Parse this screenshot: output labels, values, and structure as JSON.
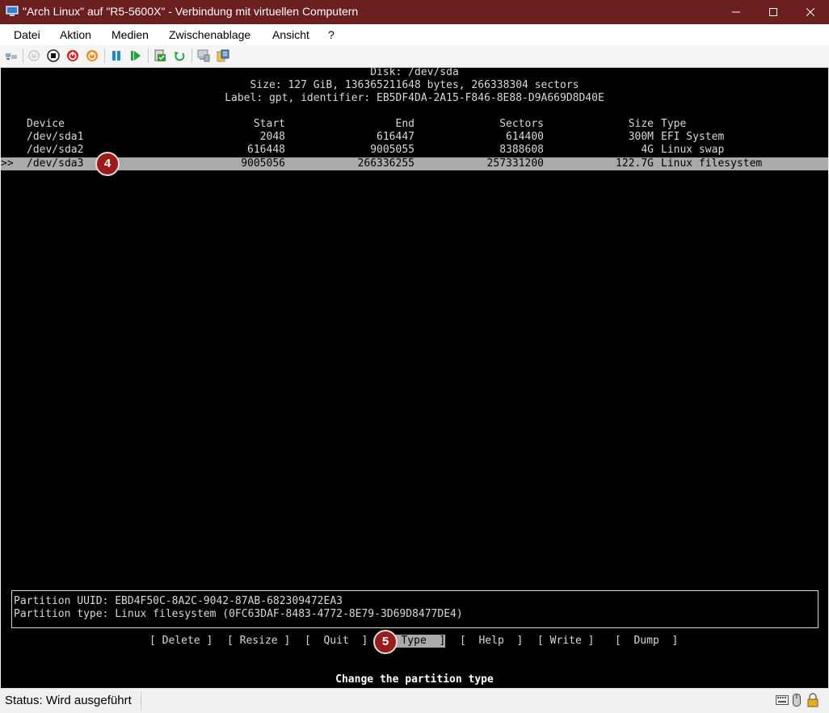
{
  "window": {
    "title": "\"Arch Linux\" auf \"R5-5600X\" - Verbindung mit virtuellen Computern"
  },
  "menu": {
    "items": [
      "Datei",
      "Aktion",
      "Medien",
      "Zwischenablage",
      "Ansicht",
      "?"
    ]
  },
  "toolbar": {
    "icons": [
      "ctrl-alt-del-icon",
      "start-icon",
      "turn-off-icon",
      "shut-down-icon",
      "power-save-icon",
      "pause-icon",
      "resume-icon",
      "checkpoint-icon",
      "revert-icon",
      "enhanced-session-icon",
      "share-icon"
    ]
  },
  "cfdisk": {
    "disk": "Disk: /dev/sda",
    "size": "Size: 127 GiB, 136365211648 bytes, 266338304 sectors",
    "label": "Label: gpt, identifier: EB5DF4DA-2A15-F846-8E88-D9A669D8D40E",
    "headers": {
      "device": "Device",
      "start": "Start",
      "end": "End",
      "sectors": "Sectors",
      "size": "Size",
      "type": "Type"
    },
    "cursor": ">>",
    "partitions": [
      {
        "device": "/dev/sda1",
        "start": "2048",
        "end": "616447",
        "sectors": "614400",
        "size": "300M",
        "type": "EFI System"
      },
      {
        "device": "/dev/sda2",
        "start": "616448",
        "end": "9005055",
        "sectors": "8388608",
        "size": "4G",
        "type": "Linux swap"
      },
      {
        "device": "/dev/sda3",
        "start": "9005056",
        "end": "266336255",
        "sectors": "257331200",
        "size": "122.7G",
        "type": "Linux filesystem"
      }
    ],
    "selected_index": 2,
    "info": {
      "uuid": "Partition UUID: EBD4F50C-8A2C-9042-87AB-682309472EA3",
      "ptype": "Partition type: Linux filesystem (0FC63DAF-8483-4772-8E79-3D69D8477DE4)"
    },
    "buttons": [
      "[ Delete ]",
      "[ Resize ]",
      "[  Quit  ]",
      "[  Type  ]",
      "[  Help  ]",
      "[ Write ]",
      "[  Dump  ]"
    ],
    "selected_button": 3,
    "hint": "Change the partition type"
  },
  "badges": [
    "4",
    "5"
  ],
  "status": {
    "text": "Status: Wird ausgeführt"
  }
}
